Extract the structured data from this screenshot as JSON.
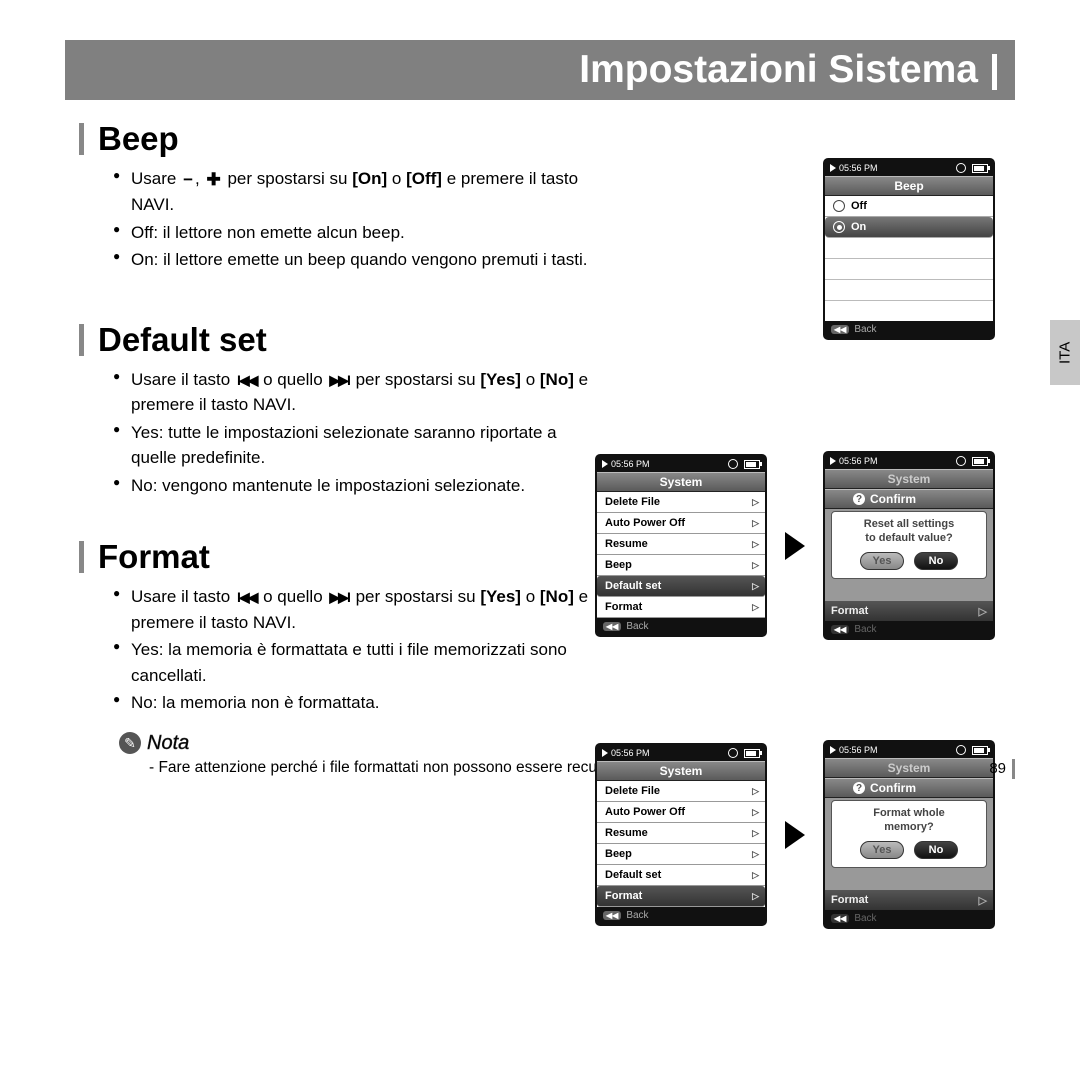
{
  "page_title": "Impostazioni Sistema",
  "side_tab": "ITA",
  "page_number": "89",
  "icons": {
    "minus": "−",
    "plus": "✚",
    "prev": "I◀◀",
    "next": "▶▶I"
  },
  "sections": {
    "beep": {
      "title": "Beep",
      "b1_a": "Usare",
      "b1_b": "per spostarsi su",
      "b1_on": "[On]",
      "b1_or": "o",
      "b1_off": "[Off]",
      "b1_c": "e premere il tasto NAVI.",
      "b2": "Off: il lettore non emette alcun beep.",
      "b3": "On: il lettore emette un beep quando vengono premuti i tasti."
    },
    "default": {
      "title": "Default set",
      "b1_a": "Usare il tasto",
      "b1_b": "o quello",
      "b1_c": "per spostarsi su",
      "b1_yes": "[Yes]",
      "b1_or": "o",
      "b1_no": "[No]",
      "b1_d": "e premere il tasto NAVI.",
      "b2": "Yes: tutte le impostazioni selezionate saranno riportate a quelle predefinite.",
      "b3": "No: vengono mantenute le impostazioni selezionate."
    },
    "format": {
      "title": "Format",
      "b1_a": "Usare il tasto",
      "b1_b": "o quello",
      "b1_c": "per spostarsi su",
      "b1_yes": "[Yes]",
      "b1_or": "o",
      "b1_no": "[No]",
      "b1_d": "e premere il tasto NAVI.",
      "b2": "Yes: la memoria è formattata e tutti i file memorizzati sono cancellati.",
      "b3": "No: la memoria non è formattata."
    }
  },
  "note": {
    "label": "Nota",
    "text": "- Fare attenzione perché i file formattati non possono essere recuperati."
  },
  "screens": {
    "time": "05:56 PM",
    "back": "Back",
    "beep": {
      "header": "Beep",
      "off": "Off",
      "on": "On"
    },
    "system": {
      "header": "System",
      "items": [
        "Delete File",
        "Auto Power Off",
        "Resume",
        "Beep",
        "Default set",
        "Format"
      ],
      "highlight_default_idx": 4,
      "highlight_format_idx": 5
    },
    "confirm": {
      "header": "Confirm",
      "reset_l1": "Reset all settings",
      "reset_l2": "to default value?",
      "fmt_l1": "Format whole",
      "fmt_l2": "memory?",
      "yes": "Yes",
      "no": "No",
      "format_below": "Format"
    }
  }
}
